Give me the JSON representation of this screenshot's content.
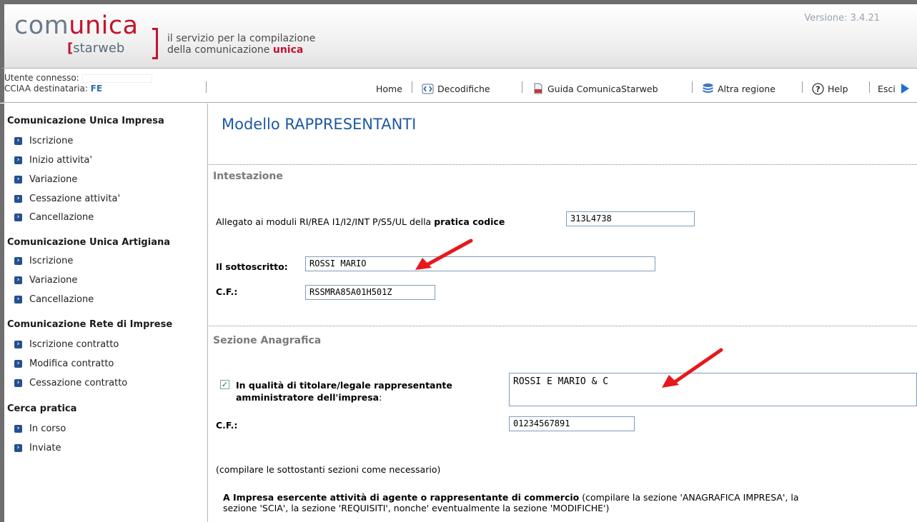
{
  "header": {
    "logo_part1": "com",
    "logo_part2": "unica",
    "logo_sub": "starweb",
    "tagline_line1": "il servizio per la compilazione",
    "tagline_line2_prefix": "della comunicazione ",
    "tagline_line2_red": "unica",
    "version": "Versione: 3.4.21"
  },
  "user": {
    "connected_label": "Utente connesso:",
    "cciaa_label": "CCIAA destinataria:",
    "cciaa_value": "FE"
  },
  "toolbar": {
    "home": "Home",
    "decodifiche": "Decodifiche",
    "guida": "Guida ComunicaStarweb",
    "altra_regione": "Altra regione",
    "help": "Help",
    "esci": "Esci"
  },
  "sidebar": {
    "sections": [
      {
        "title": "Comunicazione Unica Impresa",
        "items": [
          "Iscrizione",
          "Inizio attivita'",
          "Variazione",
          "Cessazione attivita'",
          "Cancellazione"
        ]
      },
      {
        "title": "Comunicazione Unica Artigiana",
        "items": [
          "Iscrizione",
          "Variazione",
          "Cancellazione"
        ]
      },
      {
        "title": "Comunicazione Rete di Imprese",
        "items": [
          "Iscrizione contratto",
          "Modifica contratto",
          "Cessazione contratto"
        ]
      },
      {
        "title": "Cerca pratica",
        "items": [
          "In corso",
          "Inviate"
        ]
      }
    ]
  },
  "main": {
    "title": "Modello RAPPRESENTANTI",
    "intestazione": {
      "heading": "Intestazione",
      "allegato_text": "Allegato ai moduli RI/REA I1/I2/INT P/S5/UL della ",
      "pratica_label": "pratica codice",
      "pratica_value": "313L4738",
      "sottoscritto_label": "Il sottoscritto:",
      "sottoscritto_value": "ROSSI MARIO",
      "cf_label": "C.F.:",
      "cf_value": "RSSMRA85A01H501Z"
    },
    "anagrafica": {
      "heading": "Sezione Anagrafica",
      "qualita_line1": "In qualità di titolare/legale rappresentante",
      "qualita_line2": "amministratore dell'impresa",
      "qualita_colon": ":",
      "qualita_value": "ROSSI E MARIO & C",
      "cf_label": "C.F.:",
      "cf_value": "01234567891",
      "note": "(compilare le sottostanti sezioni come necessario)",
      "sectionA_bold": "A Impresa esercente attività di agente o rappresentante di commercio",
      "sectionA_rest": " (compilare la sezione 'ANAGRAFICA IMPRESA', la",
      "sectionA_line2": "sezione 'SCIA', la sezione 'REQUISITI', nonche' eventualmente la sezione 'MODIFICHE')"
    }
  }
}
